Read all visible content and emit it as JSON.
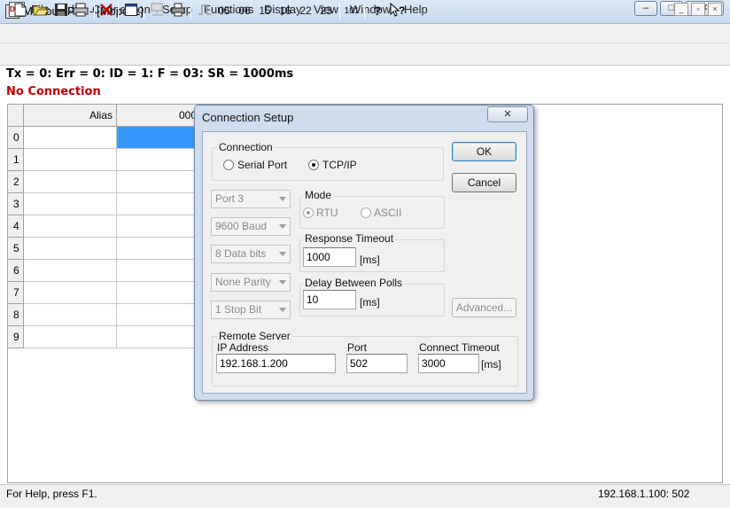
{
  "window": {
    "title": "Modbus Poll - [Mbpoll1]",
    "icon_label": "醒",
    "controls": [
      "–",
      "□",
      "✕"
    ]
  },
  "menu": {
    "doc_icon_label": "DOC",
    "items": [
      "File",
      "Edit",
      "Connection",
      "Setup",
      "Functions",
      "Display",
      "View",
      "Window",
      "Help"
    ],
    "mdi_controls": [
      "_",
      "▫",
      "×"
    ]
  },
  "toolbar": {
    "function_codes": [
      "05",
      "06",
      "15",
      "16",
      "22",
      "23"
    ],
    "code_101": "101",
    "icons": [
      "new-icon",
      "open-icon",
      "save-icon",
      "print-icon",
      "delete-icon",
      "window-icon",
      "connect-icon",
      "print-preview-icon",
      "pulse-icon",
      "help-icon",
      "context-help-icon"
    ]
  },
  "status": {
    "line": "Tx = 0: Err = 0: ID = 1: F = 03: SR = 1000ms",
    "connection": "No Connection"
  },
  "grid": {
    "header_alias": "Alias",
    "header_col": "000",
    "rows": [
      "0",
      "1",
      "2",
      "3",
      "4",
      "5",
      "6",
      "7",
      "8",
      "9"
    ]
  },
  "statusbar": {
    "help": "For Help, press F1.",
    "connection_info": "192.168.1.100: 502"
  },
  "dialog": {
    "title": "Connection Setup",
    "close_glyph": "✕",
    "connection_group": "Connection",
    "serial_port": "Serial Port",
    "tcpip": "TCP/IP",
    "selected_connection": "TCP/IP",
    "ok": "OK",
    "cancel": "Cancel",
    "port_combo": "Port 3",
    "baud_combo": "9600 Baud",
    "data_bits_combo": "8 Data bits",
    "parity_combo": "None Parity",
    "stop_bit_combo": "1 Stop Bit",
    "mode_group": "Mode",
    "rtu": "RTU",
    "ascii": "ASCII",
    "selected_mode": "RTU",
    "response_timeout_group": "Response Timeout",
    "response_timeout_value": "1000",
    "ms_unit": "[ms]",
    "delay_group": "Delay Between Polls",
    "delay_value": "10",
    "advanced": "Advanced...",
    "remote_server_group": "Remote Server",
    "ip_label": "IP Address",
    "ip_value": "192.168.1.200",
    "port_label": "Port",
    "port_value": "502",
    "connect_timeout_label": "Connect Timeout",
    "connect_timeout_value": "3000"
  }
}
